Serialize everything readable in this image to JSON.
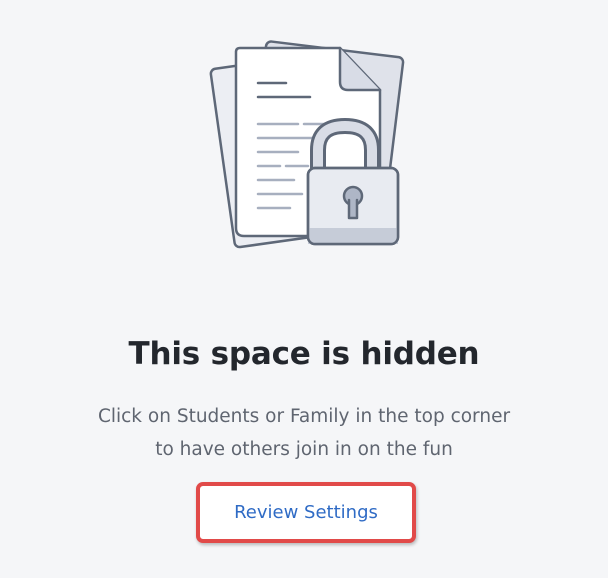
{
  "empty_state": {
    "illustration": "locked-documents-icon",
    "title": "This space is hidden",
    "message_lines": [
      "Click on Students or Family in the top corner",
      "to have others join in on the fun"
    ],
    "button_label": "Review Settings"
  },
  "colors": {
    "background": "#f5f6f8",
    "title": "#23272d",
    "text": "#5f6570",
    "link": "#2f6bc5",
    "highlight": "#e14a49"
  }
}
